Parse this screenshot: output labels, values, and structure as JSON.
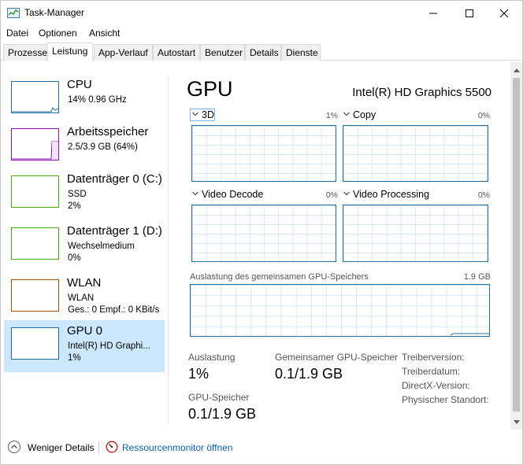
{
  "window": {
    "title": "Task-Manager"
  },
  "menu": [
    "Datei",
    "Optionen",
    "Ansicht"
  ],
  "tabs": [
    "Prozesse",
    "Leistung",
    "App-Verlauf",
    "Autostart",
    "Benutzer",
    "Details",
    "Dienste"
  ],
  "active_tab": "Leistung",
  "sidebar": {
    "items": [
      {
        "title": "CPU",
        "line1": "14% 0.96 GHz",
        "line2": "",
        "color": "#1f6e9c"
      },
      {
        "title": "Arbeitsspeicher",
        "line1": "2.5/3.9 GB (64%)",
        "line2": "",
        "color": "#8b12ae"
      },
      {
        "title": "Datenträger 0 (C:)",
        "line1": "SSD",
        "line2": "2%",
        "color": "#4da60c"
      },
      {
        "title": "Datenträger 1 (D:)",
        "line1": "Wechselmedium",
        "line2": "0%",
        "color": "#4da60c"
      },
      {
        "title": "WLAN",
        "line1": "WLAN",
        "line2": "Ges.: 0 Empf.: 0 KBit/s",
        "color": "#a74f01"
      },
      {
        "title": "GPU 0",
        "line1": "Intel(R) HD Graphi...",
        "line2": "1%",
        "color": "#1f6e9c"
      }
    ],
    "selected_index": 5
  },
  "gpu": {
    "heading": "GPU",
    "model": "Intel(R) HD Graphics 5500",
    "engines": [
      {
        "name": "3D",
        "percent": "1%"
      },
      {
        "name": "Copy",
        "percent": "0%"
      },
      {
        "name": "Video Decode",
        "percent": "0%"
      },
      {
        "name": "Video Processing",
        "percent": "0%"
      }
    ],
    "shared_memory_label": "Auslastung des gemeinsamen GPU-Speichers",
    "shared_memory_max": "1.9 GB",
    "stats": {
      "utilization_label": "Auslastung",
      "utilization_value": "1%",
      "shared_label": "Gemeinsamer GPU-Speicher",
      "shared_value": "0.1/1.9 GB",
      "gpu_memory_label": "GPU-Speicher",
      "gpu_memory_value": "0.1/1.9 GB"
    },
    "info": [
      "Treiberversion:",
      "Treiberdatum:",
      "DirectX-Version:",
      "Physischer Standort:"
    ]
  },
  "footer": {
    "fewer_details": "Weniger Details",
    "resource_monitor": "Ressourcenmonitor öffnen"
  },
  "colors": {
    "graph_border": "#1f6e9c",
    "selected_bg": "#cce8ff",
    "link": "#0a5fa8"
  }
}
